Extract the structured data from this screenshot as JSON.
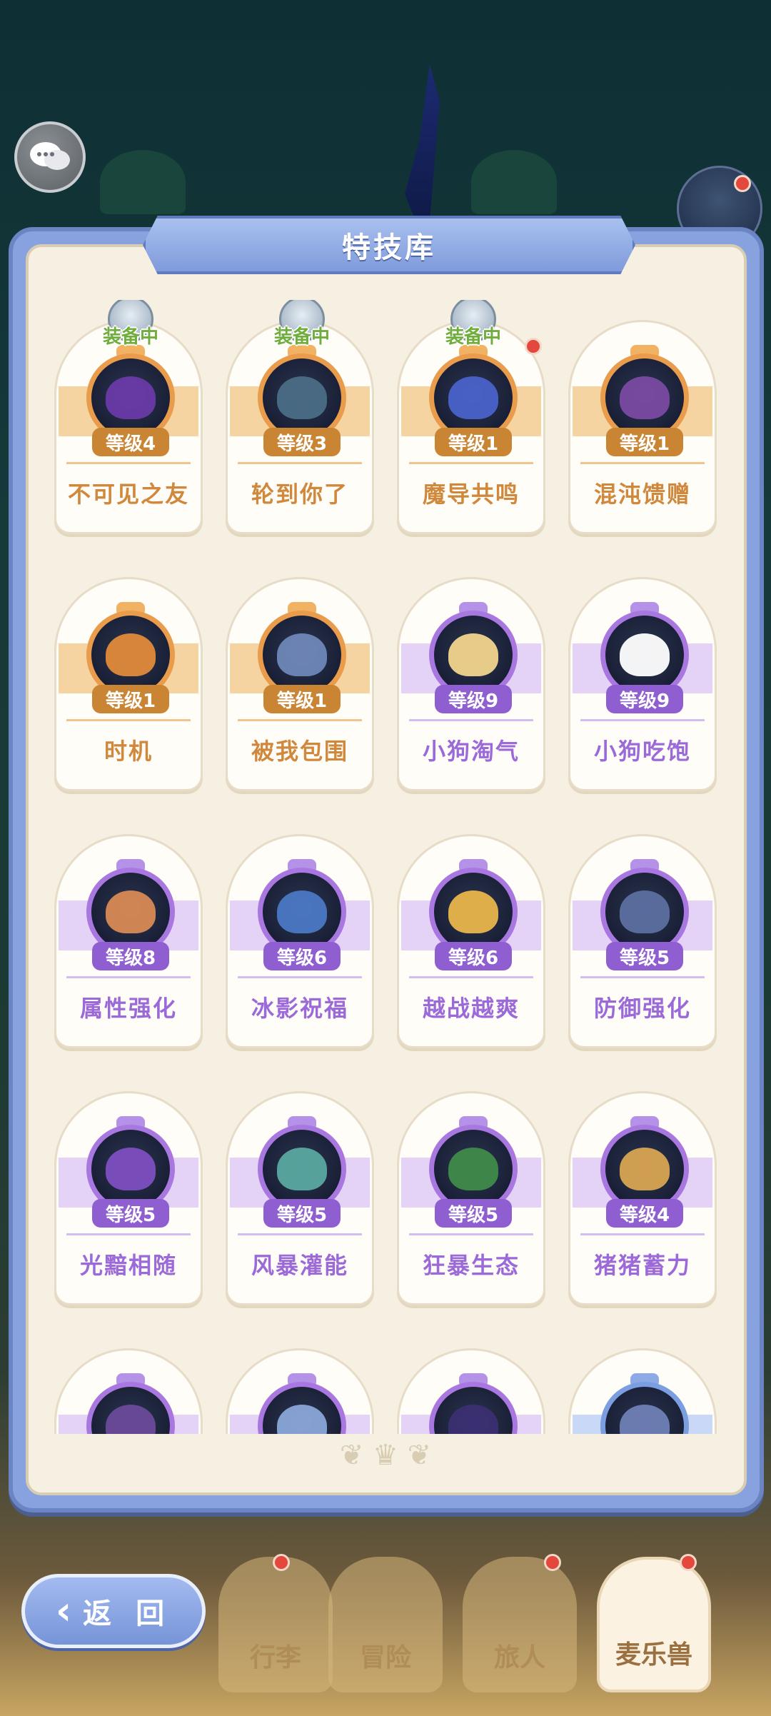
{
  "panel": {
    "title": "特技库"
  },
  "equipped_label": "装备中",
  "skills": [
    {
      "name": "不可见之友",
      "level": "等级4",
      "equipped": true,
      "theme": "orange",
      "color": "#6a3aa8"
    },
    {
      "name": "轮到你了",
      "level": "等级3",
      "equipped": true,
      "theme": "orange",
      "color": "#4b6d86"
    },
    {
      "name": "魔导共鸣",
      "level": "等级1",
      "equipped": true,
      "theme": "orange",
      "color": "#4a62c9",
      "badge_dot": true
    },
    {
      "name": "混沌馈赠",
      "level": "等级1",
      "equipped": false,
      "theme": "orange",
      "color": "#7a4aa2"
    },
    {
      "name": "时机",
      "level": "等级1",
      "equipped": false,
      "theme": "orange",
      "color": "#e08a3a"
    },
    {
      "name": "被我包围",
      "level": "等级1",
      "equipped": false,
      "theme": "orange",
      "color": "#6f87b8"
    },
    {
      "name": "小狗淘气",
      "level": "等级9",
      "equipped": false,
      "theme": "purple",
      "color": "#f2d48c"
    },
    {
      "name": "小狗吃饱",
      "level": "等级9",
      "equipped": false,
      "theme": "purple",
      "color": "#ffffff"
    },
    {
      "name": "属性强化",
      "level": "等级8",
      "equipped": false,
      "theme": "purple",
      "color": "#d88a54"
    },
    {
      "name": "冰影祝福",
      "level": "等级6",
      "equipped": false,
      "theme": "purple",
      "color": "#4b78c4"
    },
    {
      "name": "越战越爽",
      "level": "等级6",
      "equipped": false,
      "theme": "purple",
      "color": "#e8b54a"
    },
    {
      "name": "防御强化",
      "level": "等级5",
      "equipped": false,
      "theme": "purple",
      "color": "#5c6fa0"
    },
    {
      "name": "光黯相随",
      "level": "等级5",
      "equipped": false,
      "theme": "purple",
      "color": "#7d4ec0"
    },
    {
      "name": "风暴灌能",
      "level": "等级5",
      "equipped": false,
      "theme": "purple",
      "color": "#5aa8a0"
    },
    {
      "name": "狂暴生态",
      "level": "等级5",
      "equipped": false,
      "theme": "purple",
      "color": "#3f8a4a"
    },
    {
      "name": "猪猪蓄力",
      "level": "等级4",
      "equipped": false,
      "theme": "purple",
      "color": "#d8a452"
    },
    {
      "name": "",
      "level": "",
      "equipped": false,
      "theme": "purple",
      "color": "#6a4a9a"
    },
    {
      "name": "",
      "level": "",
      "equipped": false,
      "theme": "purple",
      "color": "#8aa6d8"
    },
    {
      "name": "",
      "level": "",
      "equipped": false,
      "theme": "purple",
      "color": "#3b2f72"
    },
    {
      "name": "",
      "level": "",
      "equipped": false,
      "theme": "blue",
      "color": "#6f7fb6"
    }
  ],
  "back_button": {
    "label": "返 回"
  },
  "bottom_nav": [
    {
      "label": "行李"
    },
    {
      "label": "冒险"
    },
    {
      "label": "旅人"
    },
    {
      "label": "麦乐兽"
    }
  ]
}
